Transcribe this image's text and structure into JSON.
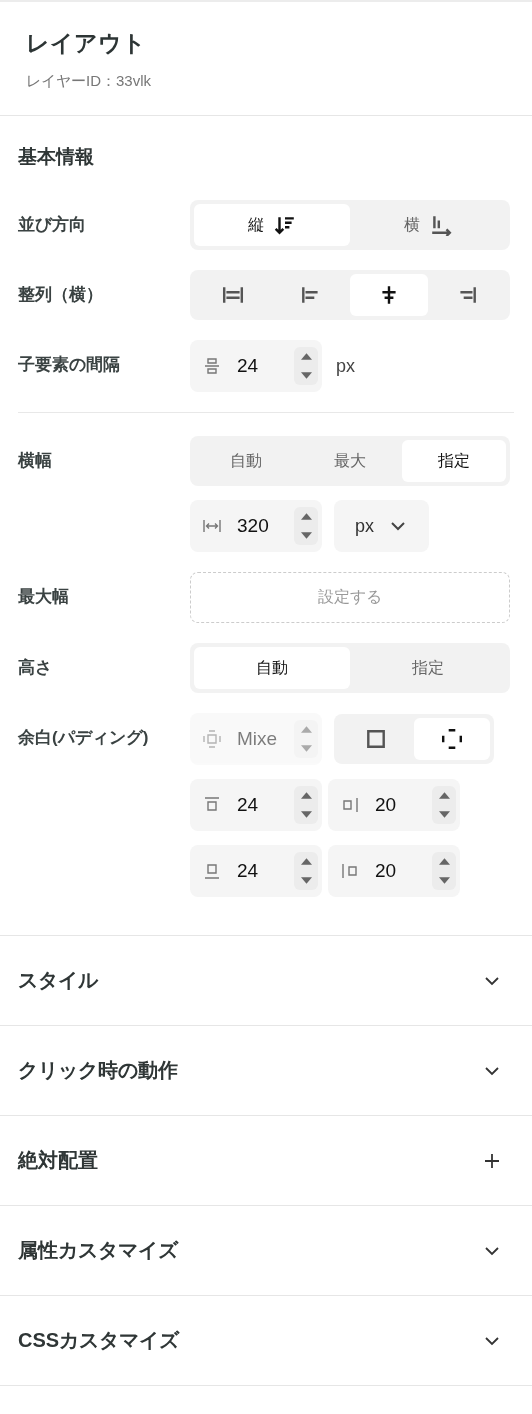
{
  "header": {
    "title": "レイアウト",
    "subtitle": "レイヤーID：33vlk"
  },
  "panel": {
    "title": "基本情報",
    "rows": [
      {
        "label": "並び方向",
        "controls": [
          {
            "kind": "segmented",
            "options": [
              {
                "label": "縦",
                "kind": "vertical",
                "selected": true
              },
              {
                "label": "横",
                "kind": "horizontal",
                "selected": false
              }
            ]
          }
        ]
      },
      {
        "label": "整列（横）",
        "controls": [
          {
            "kind": "segmented",
            "options": [
              {
                "kind": "align-stretch",
                "selected": false
              },
              {
                "kind": "align-left",
                "selected": false
              },
              {
                "kind": "align-center",
                "selected": true
              },
              {
                "kind": "align-right",
                "selected": false
              }
            ]
          }
        ]
      },
      {
        "label": "子要素の間隔",
        "controls": [
          {
            "kind": "gap",
            "value": "24",
            "unit": "px",
            "disabled": false
          }
        ]
      },
      {
        "label": "横幅",
        "divider_before": true,
        "controls": [
          {
            "kind": "segmented",
            "options": [
              {
                "label": "自動",
                "selected": false
              },
              {
                "label": "最大",
                "selected": false
              },
              {
                "label": "指定",
                "selected": true
              }
            ]
          },
          {
            "kind": "width",
            "value": "320",
            "disabled": false
          },
          {
            "kind": "select",
            "value": "px"
          }
        ]
      },
      {
        "label": "最大幅",
        "controls": [
          {
            "kind": "add",
            "label": "設定する"
          }
        ]
      },
      {
        "label": "高さ",
        "controls": [
          {
            "kind": "segmented",
            "options": [
              {
                "label": "自動",
                "selected": true
              },
              {
                "label": "指定",
                "selected": false
              }
            ]
          }
        ]
      },
      {
        "label": "余白(パディング)",
        "controls": [
          {
            "kind": "all",
            "placeholder": "Mixe",
            "disabled": true
          },
          {
            "kind": "icon-toggle",
            "options": [
              {
                "kind": "linked",
                "selected": false
              },
              {
                "kind": "separate",
                "selected": true
              }
            ]
          },
          {
            "kind": "top",
            "value": "24",
            "disabled": false
          },
          {
            "kind": "right",
            "value": "20",
            "disabled": false
          },
          {
            "kind": "bottom",
            "value": "24",
            "disabled": false
          },
          {
            "kind": "left",
            "value": "20",
            "disabled": false
          }
        ]
      }
    ]
  },
  "sections": [
    {
      "title": "スタイル",
      "kind": "collapsible"
    },
    {
      "title": "クリック時の動作",
      "kind": "collapsible"
    },
    {
      "title": "絶対配置",
      "kind": "addable"
    },
    {
      "title": "属性カスタマイズ",
      "kind": "collapsible"
    },
    {
      "title": "CSSカスタマイズ",
      "kind": "collapsible"
    }
  ]
}
